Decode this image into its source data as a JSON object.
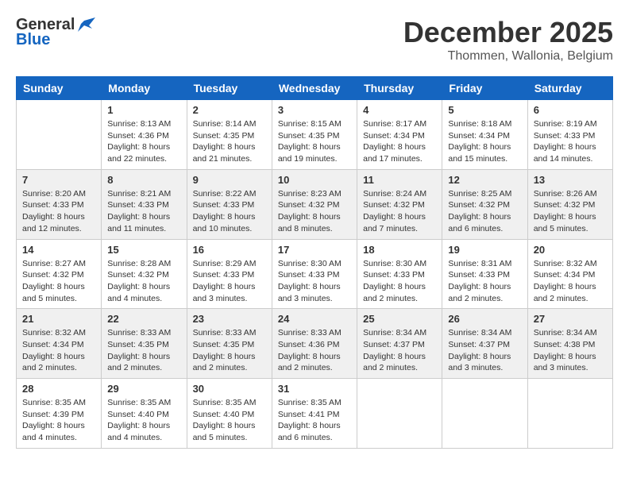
{
  "logo": {
    "general": "General",
    "blue": "Blue"
  },
  "title": "December 2025",
  "subtitle": "Thommen, Wallonia, Belgium",
  "days_of_week": [
    "Sunday",
    "Monday",
    "Tuesday",
    "Wednesday",
    "Thursday",
    "Friday",
    "Saturday"
  ],
  "weeks": [
    [
      {
        "day": "",
        "info": ""
      },
      {
        "day": "1",
        "info": "Sunrise: 8:13 AM\nSunset: 4:36 PM\nDaylight: 8 hours\nand 22 minutes."
      },
      {
        "day": "2",
        "info": "Sunrise: 8:14 AM\nSunset: 4:35 PM\nDaylight: 8 hours\nand 21 minutes."
      },
      {
        "day": "3",
        "info": "Sunrise: 8:15 AM\nSunset: 4:35 PM\nDaylight: 8 hours\nand 19 minutes."
      },
      {
        "day": "4",
        "info": "Sunrise: 8:17 AM\nSunset: 4:34 PM\nDaylight: 8 hours\nand 17 minutes."
      },
      {
        "day": "5",
        "info": "Sunrise: 8:18 AM\nSunset: 4:34 PM\nDaylight: 8 hours\nand 15 minutes."
      },
      {
        "day": "6",
        "info": "Sunrise: 8:19 AM\nSunset: 4:33 PM\nDaylight: 8 hours\nand 14 minutes."
      }
    ],
    [
      {
        "day": "7",
        "info": "Sunrise: 8:20 AM\nSunset: 4:33 PM\nDaylight: 8 hours\nand 12 minutes."
      },
      {
        "day": "8",
        "info": "Sunrise: 8:21 AM\nSunset: 4:33 PM\nDaylight: 8 hours\nand 11 minutes."
      },
      {
        "day": "9",
        "info": "Sunrise: 8:22 AM\nSunset: 4:33 PM\nDaylight: 8 hours\nand 10 minutes."
      },
      {
        "day": "10",
        "info": "Sunrise: 8:23 AM\nSunset: 4:32 PM\nDaylight: 8 hours\nand 8 minutes."
      },
      {
        "day": "11",
        "info": "Sunrise: 8:24 AM\nSunset: 4:32 PM\nDaylight: 8 hours\nand 7 minutes."
      },
      {
        "day": "12",
        "info": "Sunrise: 8:25 AM\nSunset: 4:32 PM\nDaylight: 8 hours\nand 6 minutes."
      },
      {
        "day": "13",
        "info": "Sunrise: 8:26 AM\nSunset: 4:32 PM\nDaylight: 8 hours\nand 5 minutes."
      }
    ],
    [
      {
        "day": "14",
        "info": "Sunrise: 8:27 AM\nSunset: 4:32 PM\nDaylight: 8 hours\nand 5 minutes."
      },
      {
        "day": "15",
        "info": "Sunrise: 8:28 AM\nSunset: 4:32 PM\nDaylight: 8 hours\nand 4 minutes."
      },
      {
        "day": "16",
        "info": "Sunrise: 8:29 AM\nSunset: 4:33 PM\nDaylight: 8 hours\nand 3 minutes."
      },
      {
        "day": "17",
        "info": "Sunrise: 8:30 AM\nSunset: 4:33 PM\nDaylight: 8 hours\nand 3 minutes."
      },
      {
        "day": "18",
        "info": "Sunrise: 8:30 AM\nSunset: 4:33 PM\nDaylight: 8 hours\nand 2 minutes."
      },
      {
        "day": "19",
        "info": "Sunrise: 8:31 AM\nSunset: 4:33 PM\nDaylight: 8 hours\nand 2 minutes."
      },
      {
        "day": "20",
        "info": "Sunrise: 8:32 AM\nSunset: 4:34 PM\nDaylight: 8 hours\nand 2 minutes."
      }
    ],
    [
      {
        "day": "21",
        "info": "Sunrise: 8:32 AM\nSunset: 4:34 PM\nDaylight: 8 hours\nand 2 minutes."
      },
      {
        "day": "22",
        "info": "Sunrise: 8:33 AM\nSunset: 4:35 PM\nDaylight: 8 hours\nand 2 minutes."
      },
      {
        "day": "23",
        "info": "Sunrise: 8:33 AM\nSunset: 4:35 PM\nDaylight: 8 hours\nand 2 minutes."
      },
      {
        "day": "24",
        "info": "Sunrise: 8:33 AM\nSunset: 4:36 PM\nDaylight: 8 hours\nand 2 minutes."
      },
      {
        "day": "25",
        "info": "Sunrise: 8:34 AM\nSunset: 4:37 PM\nDaylight: 8 hours\nand 2 minutes."
      },
      {
        "day": "26",
        "info": "Sunrise: 8:34 AM\nSunset: 4:37 PM\nDaylight: 8 hours\nand 3 minutes."
      },
      {
        "day": "27",
        "info": "Sunrise: 8:34 AM\nSunset: 4:38 PM\nDaylight: 8 hours\nand 3 minutes."
      }
    ],
    [
      {
        "day": "28",
        "info": "Sunrise: 8:35 AM\nSunset: 4:39 PM\nDaylight: 8 hours\nand 4 minutes."
      },
      {
        "day": "29",
        "info": "Sunrise: 8:35 AM\nSunset: 4:40 PM\nDaylight: 8 hours\nand 4 minutes."
      },
      {
        "day": "30",
        "info": "Sunrise: 8:35 AM\nSunset: 4:40 PM\nDaylight: 8 hours\nand 5 minutes."
      },
      {
        "day": "31",
        "info": "Sunrise: 8:35 AM\nSunset: 4:41 PM\nDaylight: 8 hours\nand 6 minutes."
      },
      {
        "day": "",
        "info": ""
      },
      {
        "day": "",
        "info": ""
      },
      {
        "day": "",
        "info": ""
      }
    ]
  ]
}
